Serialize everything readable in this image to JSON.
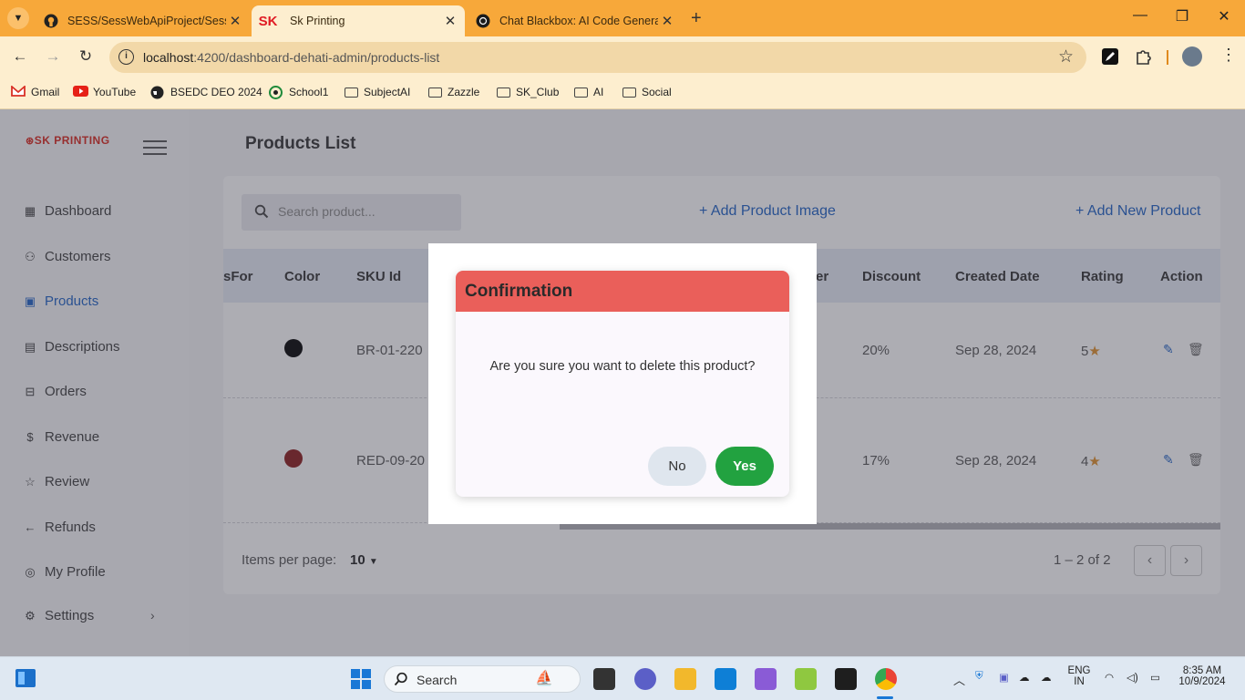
{
  "browser": {
    "tabs": [
      {
        "title": "SESS/SessWebApiProject/SessW",
        "icon": "github-icon"
      },
      {
        "title": "Sk Printing",
        "icon": "sk-icon",
        "active": true
      },
      {
        "title": "Chat Blackbox: AI Code Generat",
        "icon": "blackbox-icon"
      }
    ],
    "url_host": "localhost",
    "url_rest": ":4200/dashboard-dehati-admin/products-list",
    "bookmarks": [
      {
        "label": "Gmail",
        "icon": "gmail-icon"
      },
      {
        "label": "YouTube",
        "icon": "youtube-icon"
      },
      {
        "label": "BSEDC DEO 2024",
        "icon": "globe-icon"
      },
      {
        "label": "School1",
        "icon": "school-icon"
      },
      {
        "label": "SubjectAI",
        "icon": "folder-icon"
      },
      {
        "label": "Zazzle",
        "icon": "folder-icon"
      },
      {
        "label": "SK_Club",
        "icon": "folder-icon"
      },
      {
        "label": "AI",
        "icon": "folder-icon"
      },
      {
        "label": "Social",
        "icon": "folder-icon"
      }
    ]
  },
  "sidebar": {
    "logo": "SK PRINTING",
    "items": [
      {
        "label": "Dashboard",
        "icon": "dashboard-icon"
      },
      {
        "label": "Customers",
        "icon": "customers-icon"
      },
      {
        "label": "Products",
        "icon": "products-icon",
        "active": true
      },
      {
        "label": "Descriptions",
        "icon": "document-icon"
      },
      {
        "label": "Orders",
        "icon": "orders-icon"
      },
      {
        "label": "Revenue",
        "icon": "dollar-icon"
      },
      {
        "label": "Review",
        "icon": "review-icon"
      },
      {
        "label": "Refunds",
        "icon": "refund-icon"
      },
      {
        "label": "My Profile",
        "icon": "profile-icon"
      },
      {
        "label": "Settings",
        "icon": "gear-icon"
      }
    ]
  },
  "main": {
    "title": "Products List",
    "search_placeholder": "Search product...",
    "add_image": "+ Add Product Image",
    "add_product": "+ Add New Product",
    "columns": [
      "sFor",
      "Color",
      "SKU Id",
      "er",
      "Discount",
      "Created Date",
      "Rating",
      "Action"
    ],
    "rows": [
      {
        "color": "#000000",
        "sku": "BR-01-220",
        "discount": "20%",
        "created": "Sep 28, 2024",
        "rating": "5"
      },
      {
        "color": "#8b1a1a",
        "sku": "RED-09-20",
        "discount": "17%",
        "created": "Sep 28, 2024",
        "rating": "4"
      }
    ],
    "paginator": {
      "label": "Items per page:",
      "page_size": "10",
      "range": "1 – 2 of 2"
    }
  },
  "dialog": {
    "title": "Confirmation",
    "message": "Are you sure you want to delete this product?",
    "no": "No",
    "yes": "Yes"
  },
  "taskbar": {
    "search": "Search",
    "lang_1": "ENG",
    "lang_2": "IN",
    "time": "8:35 AM",
    "date": "10/9/2024"
  },
  "colors": {
    "accent": "#1e61c4",
    "dialog_header": "#ea5f5a",
    "yes_button": "#22a240",
    "star": "#e0902a"
  }
}
